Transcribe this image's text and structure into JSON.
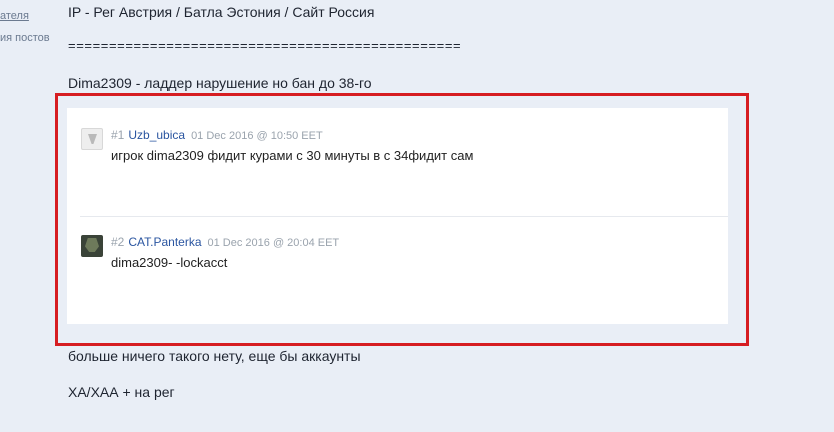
{
  "sidebar": {
    "link_text": "ателя",
    "text": "ия постов"
  },
  "post": {
    "line1": "IP - Рег Австрия / Батла Эстония / Сайт Россия",
    "separator": "================================================",
    "line2": "Dima2309 - ладдер нарушение но бан до 38-го",
    "line3": "больше ничего такого нету, еще бы аккаунты",
    "line4": "ХА/ХАА + на рег"
  },
  "quote": {
    "entries": [
      {
        "number": "#1",
        "username": "Uzb_ubica",
        "date": "01 Dec 2016 @ 10:50 EET",
        "message": "игрок dima2309 фидит курами с 30 минуты в с 34фидит сам"
      },
      {
        "number": "#2",
        "username": "CAT.Panterka",
        "date": "01 Dec 2016 @ 20:04 EET",
        "message": "dima2309- -lockacct"
      }
    ]
  },
  "colors": {
    "background": "#e9eef6",
    "highlight_border": "#d61d22",
    "username_link": "#2a55a0"
  }
}
